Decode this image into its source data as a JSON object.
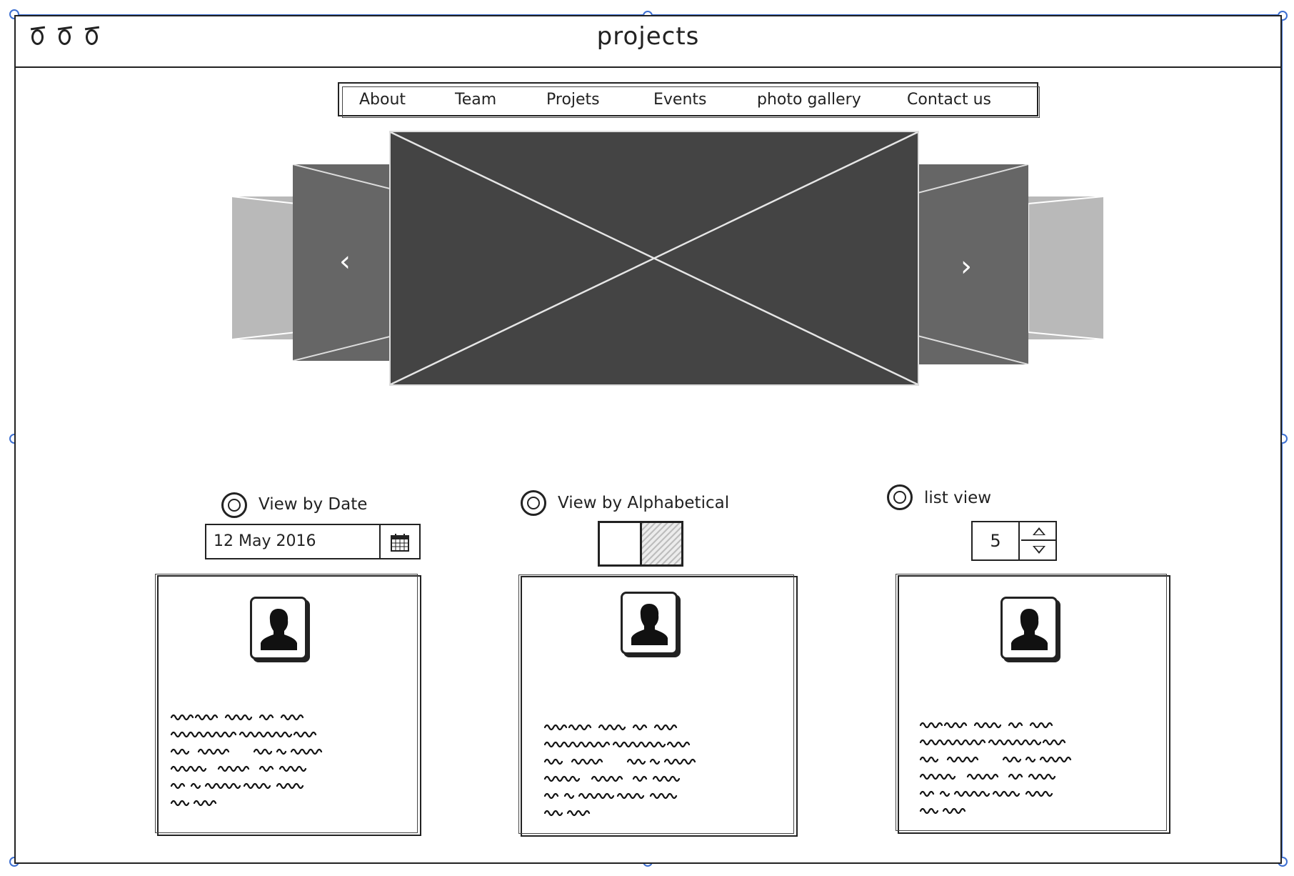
{
  "window": {
    "title": "projects"
  },
  "nav": {
    "items": [
      "About",
      "Team",
      "Projets",
      "Events",
      "photo gallery",
      "Contact us"
    ]
  },
  "carousel": {
    "prev_glyph": "‹",
    "next_glyph": "›"
  },
  "filters": {
    "date": {
      "label": "View by Date",
      "value": "12 May 2016"
    },
    "alpha": {
      "label": "View by Alphabetical"
    },
    "list": {
      "label": "list view",
      "value": "5"
    }
  },
  "colors": {
    "selection": "#3d6fd1",
    "ink": "#222222",
    "slide_main": "#444444",
    "slide_side": "#666666",
    "slide_far": "#b9b9b9"
  }
}
